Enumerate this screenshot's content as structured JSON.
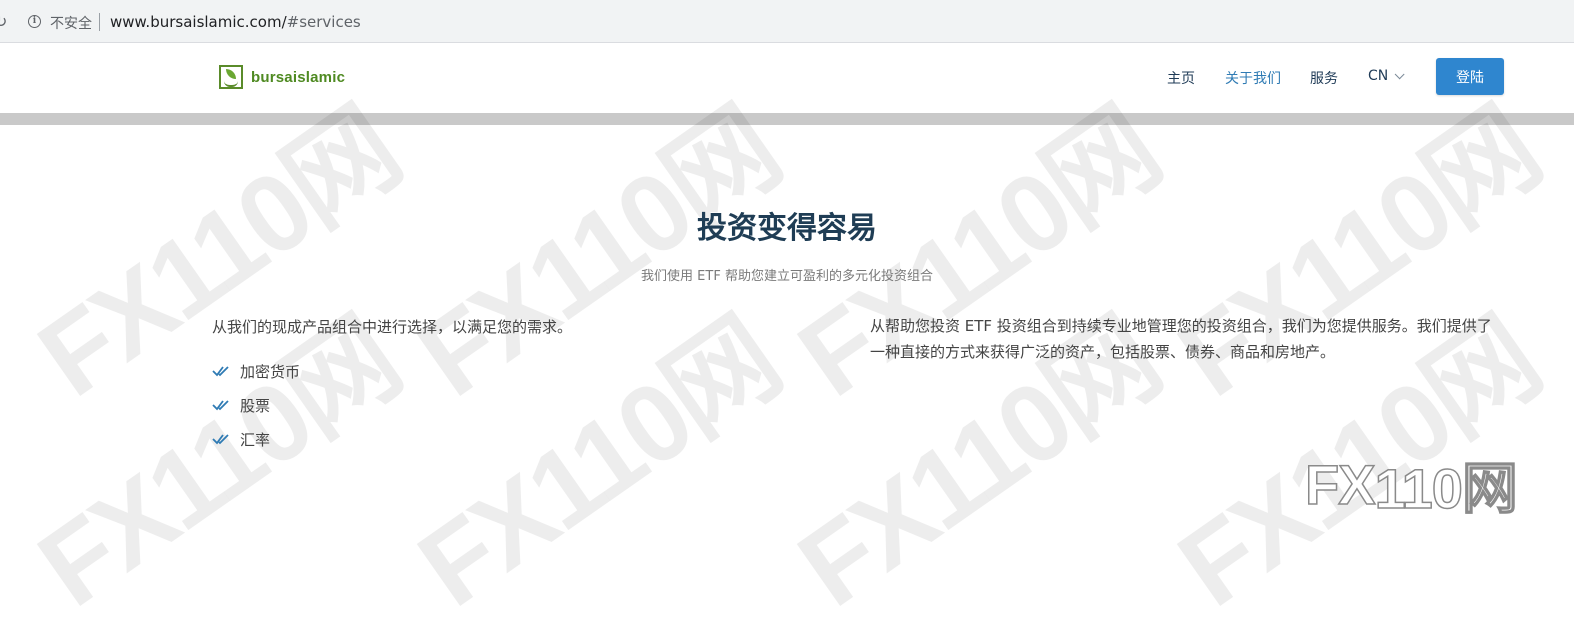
{
  "browser": {
    "security_label": "不安全",
    "url_host": "www.bursaislamic.com/",
    "url_hash": "#services"
  },
  "header": {
    "logo_text": "bursaislamic",
    "nav": {
      "home": "主页",
      "about": "关于我们",
      "services": "服务",
      "language": "CN"
    },
    "login_label": "登陆"
  },
  "main": {
    "title": "投资变得容易",
    "subtitle": "我们使用 ETF 帮助您建立可盈利的多元化投资组合",
    "left_intro": "从我们的现成产品组合中进行选择，以满足您的需求。",
    "features": [
      "加密货币",
      "股票",
      "汇率"
    ],
    "right_text": "从帮助您投资 ETF 投资组合到持续专业地管理您的投资组合，我们为您提供服务。我们提供了一种直接的方式来获得广泛的资产，包括股票、债券、商品和房地产。"
  },
  "watermark": {
    "text": "FX110网",
    "corner_prefix": "FX",
    "corner_text": "110网"
  },
  "colors": {
    "brand_green": "#4f8a22",
    "title_navy": "#1f3d55",
    "nav_active_blue": "#2f7bb4",
    "login_blue": "#2f86cf"
  }
}
